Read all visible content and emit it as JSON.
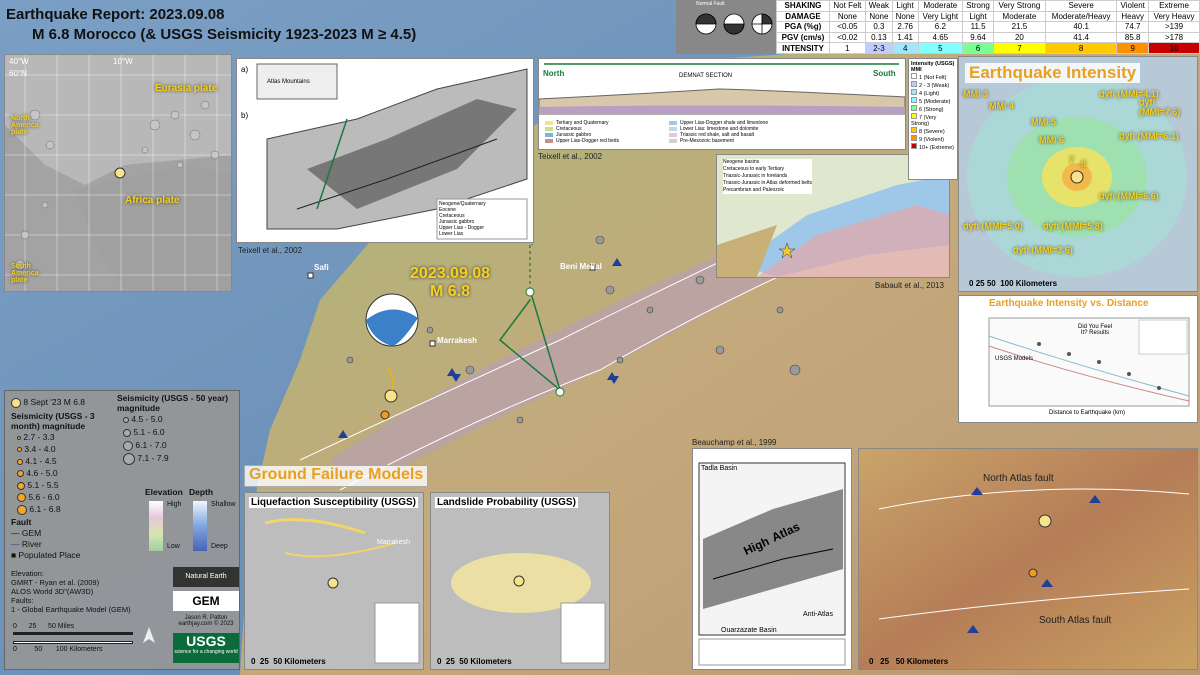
{
  "title": {
    "line1": "Earthquake Report: 2023.09.08",
    "line2": "M 6.8 Morocco (& USGS Seismicity 1923-2023 M ≥ 4.5)"
  },
  "main_map": {
    "event_date": "2023.09.08",
    "event_mag": "M 6.8",
    "cities": [
      "Safi",
      "Marrakesh",
      "Beni Mellal"
    ]
  },
  "inset_global": {
    "plates": [
      "Eurasia plate",
      "North America plate",
      "Africa plate",
      "South America plate"
    ],
    "lon_labels": [
      "40°W",
      "30°W",
      "20°W",
      "10°W",
      "0°",
      "10°E",
      "20°E"
    ],
    "lat_labels": [
      "60°N",
      "50°N",
      "40°N",
      "30°N",
      "20°N",
      "10°N"
    ]
  },
  "teixell_inset": {
    "caption": "Teixell et al., 2002",
    "panel_a": "a)",
    "panel_b": "b)",
    "atlas_label": "Atlas Mountains",
    "legend": [
      "Neogene/Quaternary",
      "Eocene",
      "Cretaceous",
      "Jurassic gabbro",
      "Upper Lias - Dogger",
      "Lower Lias",
      "Triassic",
      "Precambrian and Paleozoic basement"
    ]
  },
  "section_inset": {
    "north": "North",
    "south": "South",
    "title": "DEMNAT SECTION",
    "caption": "Teixell et al., 2002",
    "legend": [
      "Tertiary and Quaternary",
      "Cretaceous",
      "Jurassic gabbro",
      "Upper Lias-Dogger red beds",
      "Upper Lias-Dogger shale and limestone",
      "Lower Lias: limestone and dolomite",
      "Triassic red shale, salt and basalt",
      "Pre-Mesozoic basement"
    ]
  },
  "geology_inset": {
    "caption": "Babault et al., 2013",
    "legend": [
      "Neogene basins",
      "Cretaceous to early Tertiary",
      "Triassic-Jurassic in forelands",
      "Triassic-Jurassic in Atlas deformed belts",
      "Precambrian and Paleozoic"
    ]
  },
  "mmi_legend": {
    "title": "Intensity (USGS) MMI",
    "items": [
      "1 (Not Felt)",
      "2 - 3 (Weak)",
      "4 (Light)",
      "5 (Moderate)",
      "6 (Strong)",
      "7 (Very Strong)",
      "8 (Severe)",
      "9 (Violent)",
      "10+ (Extreme)"
    ],
    "colors": [
      "#ffffff",
      "#bfccff",
      "#a0e6ff",
      "#80ffff",
      "#7aff93",
      "#ffff00",
      "#ffc800",
      "#ff9100",
      "#c80000"
    ]
  },
  "shaking_table": {
    "rows": [
      {
        "label": "SHAKING",
        "values": [
          "Not Felt",
          "Weak",
          "Light",
          "Moderate",
          "Strong",
          "Very Strong",
          "Severe",
          "Violent",
          "Extreme"
        ]
      },
      {
        "label": "DAMAGE",
        "values": [
          "None",
          "None",
          "None",
          "Very Light",
          "Light",
          "Moderate",
          "Moderate/Heavy",
          "Heavy",
          "Very Heavy"
        ]
      },
      {
        "label": "PGA (%g)",
        "values": [
          "<0.05",
          "0.3",
          "2.76",
          "6.2",
          "11.5",
          "21.5",
          "40.1",
          "74.7",
          ">139"
        ]
      },
      {
        "label": "PGV (cm/s)",
        "values": [
          "<0.02",
          "0.13",
          "1.41",
          "4.65",
          "9.64",
          "20",
          "41.4",
          "85.8",
          ">178"
        ]
      },
      {
        "label": "INTENSITY",
        "values": [
          "1",
          "2-3",
          "4",
          "5",
          "6",
          "7",
          "8",
          "9",
          "10"
        ]
      }
    ],
    "mechanisms": [
      "Normal Fault",
      "Thrust Fault",
      "Strike Slip Fault"
    ]
  },
  "intensity_map": {
    "title": "Earthquake Intensity",
    "labels": [
      "MMI 3",
      "MMI 4",
      "MMI 5",
      "MMI 6",
      "7",
      "8",
      "dyfi (MMI=4.1)",
      "dyfi (MMI=7.6)",
      "dyfi (MMI=6.1)",
      "dyfi (MMI=6.6)",
      "dyfi (MMI=5.0)",
      "dyfi (MMI=5.8)",
      "dyfi (MMI=3.6)"
    ],
    "scale": [
      "0",
      "25",
      "50",
      "100 Kilometers"
    ]
  },
  "intensity_chart": {
    "title": "Earthquake Intensity vs. Distance",
    "xlabel": "Distance to Earthquake (km)",
    "ylabel": "Intensity (MMI)",
    "annotations": [
      "Did You Feel It? Results",
      "USGS Models"
    ]
  },
  "legend": {
    "event": "8 Sept '23 M 6.8",
    "seis3_title": "Seismicity (USGS - 3 month) magnitude",
    "seis3": [
      "2.7 - 3.3",
      "3.4 - 4.0",
      "4.1 - 4.5",
      "4.6 - 5.0",
      "5.1 - 5.5",
      "5.6 - 6.0",
      "6.1 - 6.8"
    ],
    "seis50_title": "Seismicity (USGS - 50 year) magnitude",
    "seis50": [
      "4.5 - 5.0",
      "5.1 - 6.0",
      "6.1 - 7.0",
      "7.1 - 7.9"
    ],
    "elevation": "Elevation",
    "depth": "Depth",
    "high": "High",
    "low": "Low",
    "shallow": "Shallow",
    "deep": "Deep",
    "fault": "Fault",
    "gem": "GEM",
    "river": "River",
    "populated": "Populated Place",
    "credits": [
      "Elevation:",
      "GMRT - Ryan et al. (2009)",
      "ALOS World 3D\"(AW3D)",
      "Faults:",
      "1 - Global Earthquake Model (GEM)"
    ],
    "scale_miles": [
      "0",
      "25",
      "50 Miles"
    ],
    "scale_km": [
      "0",
      "50",
      "100 Kilometers"
    ],
    "author": "Jason R. Patton",
    "site": "earthjay.com © 2023",
    "natural_earth": "Natural Earth",
    "gem_logo": "GEM",
    "usgs": "USGS",
    "usgs_tag": "science for a changing world"
  },
  "ground_failure": {
    "title": "Ground Failure Models",
    "liq_title": "Liquefaction Susceptibility (USGS)",
    "ls_title": "Landslide Probability (USGS)",
    "liq_city": "Marrakesh",
    "scale": [
      "0",
      "25",
      "50 Kilometers"
    ]
  },
  "highatlas_inset": {
    "caption": "Beauchamp et al., 1999",
    "labels": [
      "Tadla Basin",
      "High",
      "Atlas",
      "Ouarzazate Basin",
      "Anti-Atlas"
    ]
  },
  "relief_inset": {
    "north_fault": "North Atlas fault",
    "south_fault": "South Atlas fault",
    "scale": [
      "0",
      "25",
      "50 Kilometers"
    ]
  }
}
